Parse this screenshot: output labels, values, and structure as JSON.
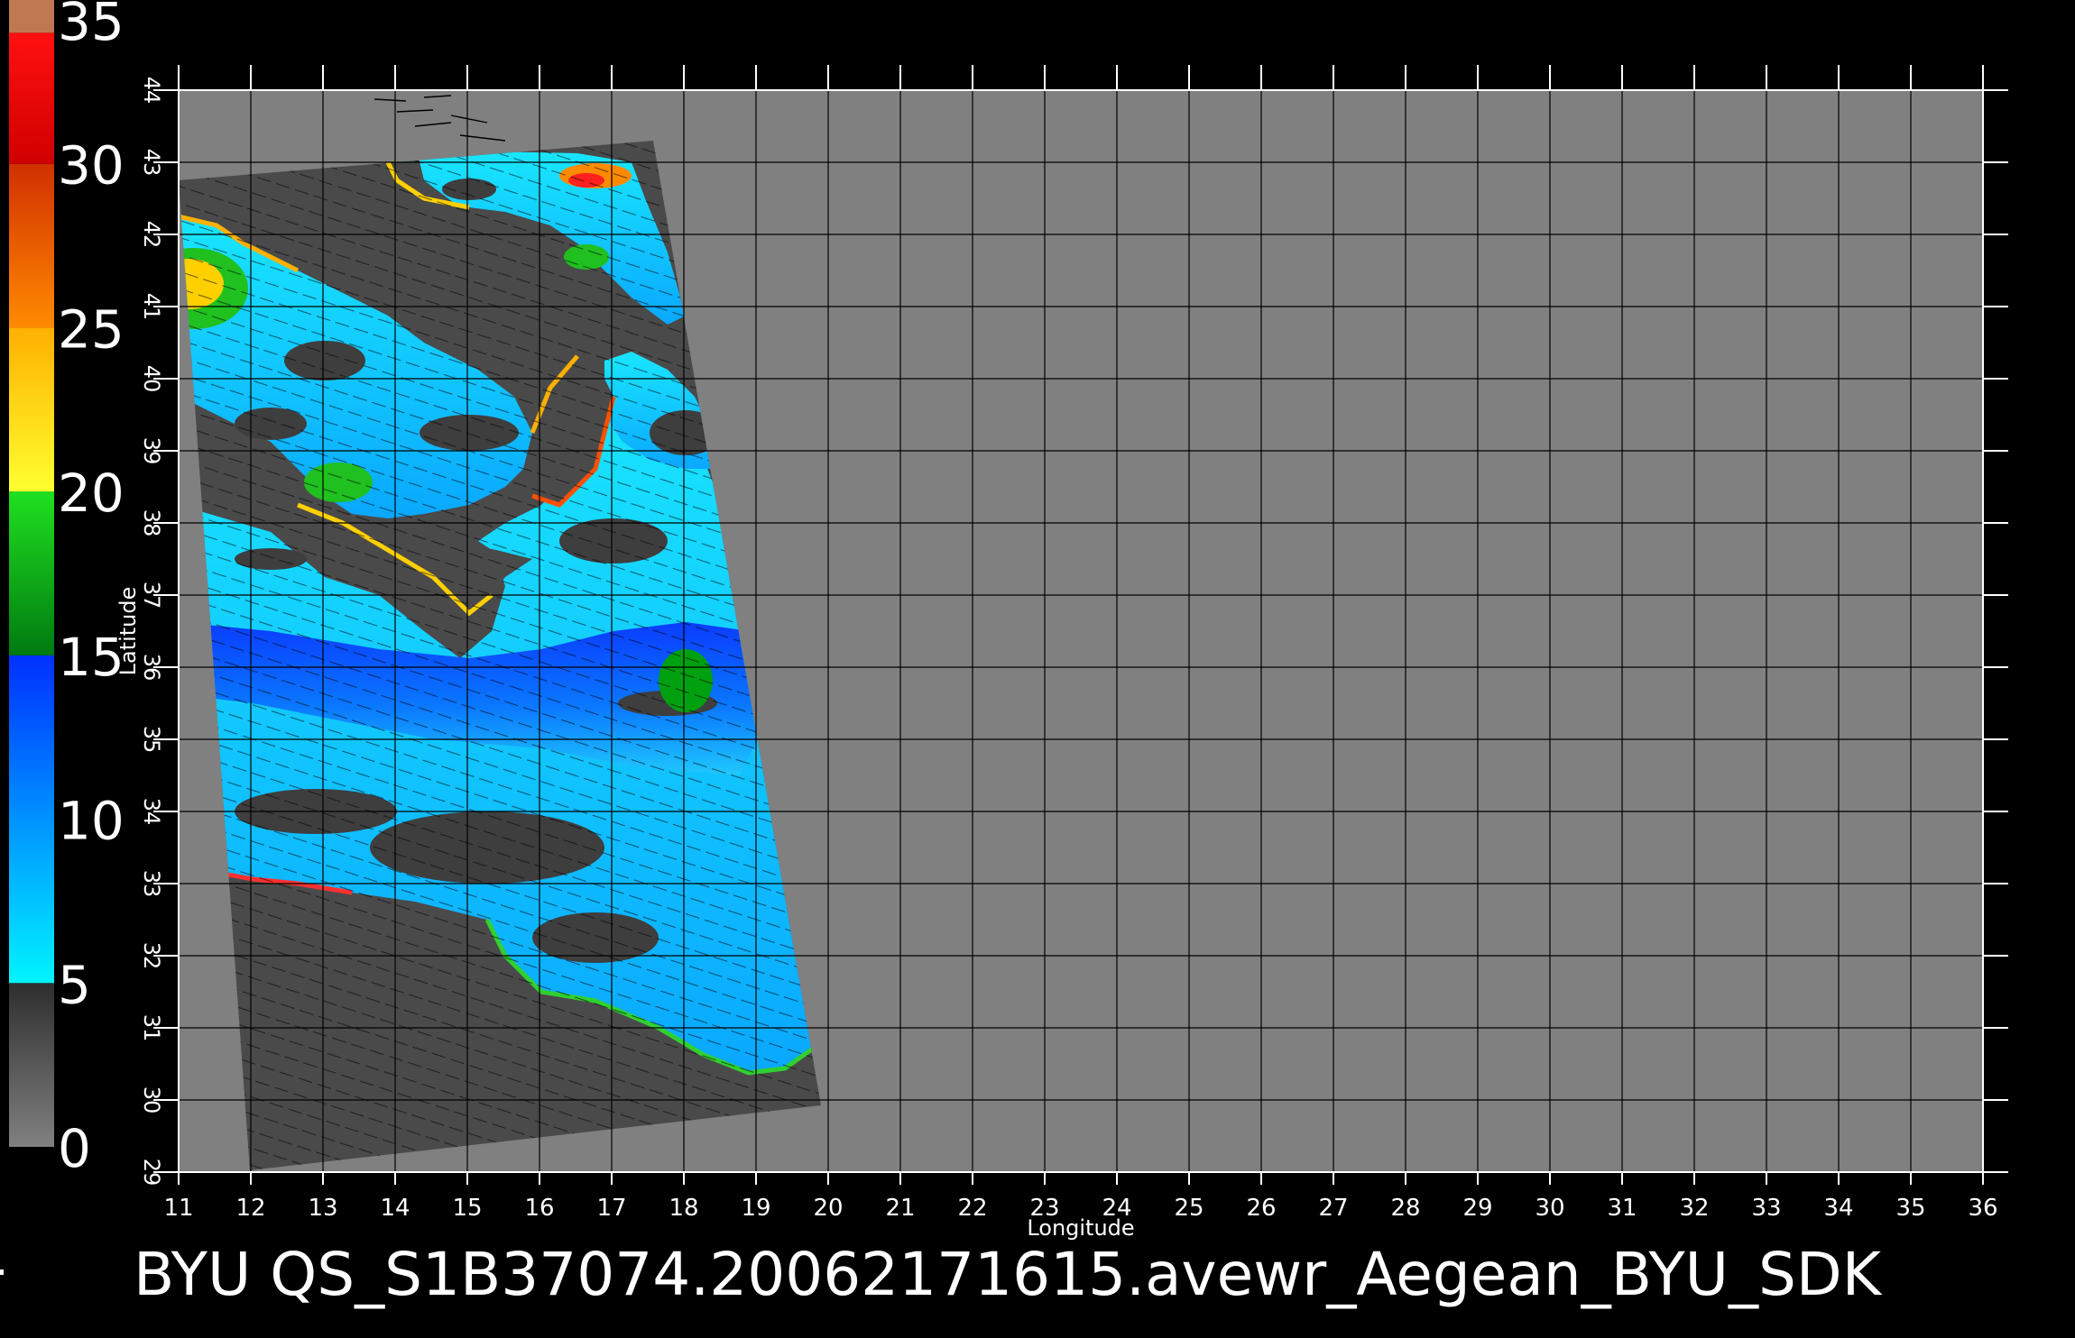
{
  "title_text": "BYU  QS_S1B37074.20062171615.avewr_Aegean_BYU_SDK",
  "colorbar": {
    "labels": [
      "35",
      "30",
      "25",
      "20",
      "15",
      "10",
      "5",
      "0"
    ],
    "bands": [
      {
        "from": 0,
        "to": 5,
        "colors": [
          "#808080",
          "#2e2e2e"
        ]
      },
      {
        "from": 5,
        "to": 15,
        "colors": [
          "#00f4ff",
          "#0030ff"
        ]
      },
      {
        "from": 15,
        "to": 20,
        "colors": [
          "#007a10",
          "#20e020"
        ]
      },
      {
        "from": 20,
        "to": 25,
        "colors": [
          "#ffff30",
          "#ffb000"
        ]
      },
      {
        "from": 25,
        "to": 30,
        "colors": [
          "#ff8a00",
          "#d03000"
        ]
      },
      {
        "from": 30,
        "to": 34,
        "colors": [
          "#d00000",
          "#ff1010"
        ]
      },
      {
        "from": 34,
        "to": 35,
        "colors": [
          "#c07850",
          "#c07850"
        ]
      }
    ],
    "range": [
      0,
      35
    ]
  },
  "map": {
    "x_axis_label": "Longitude",
    "y_axis_label": "Latitude",
    "lon_ticks": [
      "11",
      "12",
      "13",
      "14",
      "15",
      "16",
      "17",
      "18",
      "19",
      "20",
      "21",
      "22",
      "23",
      "24",
      "25",
      "26",
      "27",
      "28",
      "29",
      "30",
      "31",
      "32",
      "33",
      "34",
      "35",
      "36"
    ],
    "lat_ticks": [
      "29",
      "30",
      "31",
      "32",
      "33",
      "34",
      "35",
      "36",
      "37",
      "38",
      "39",
      "40",
      "41",
      "42",
      "43",
      "44"
    ],
    "lon_range": [
      11,
      36
    ],
    "lat_range": [
      29,
      44
    ],
    "background_color": "#808080",
    "swath_no_data_color": "#4a4a4a",
    "grid_color": "#000000"
  }
}
